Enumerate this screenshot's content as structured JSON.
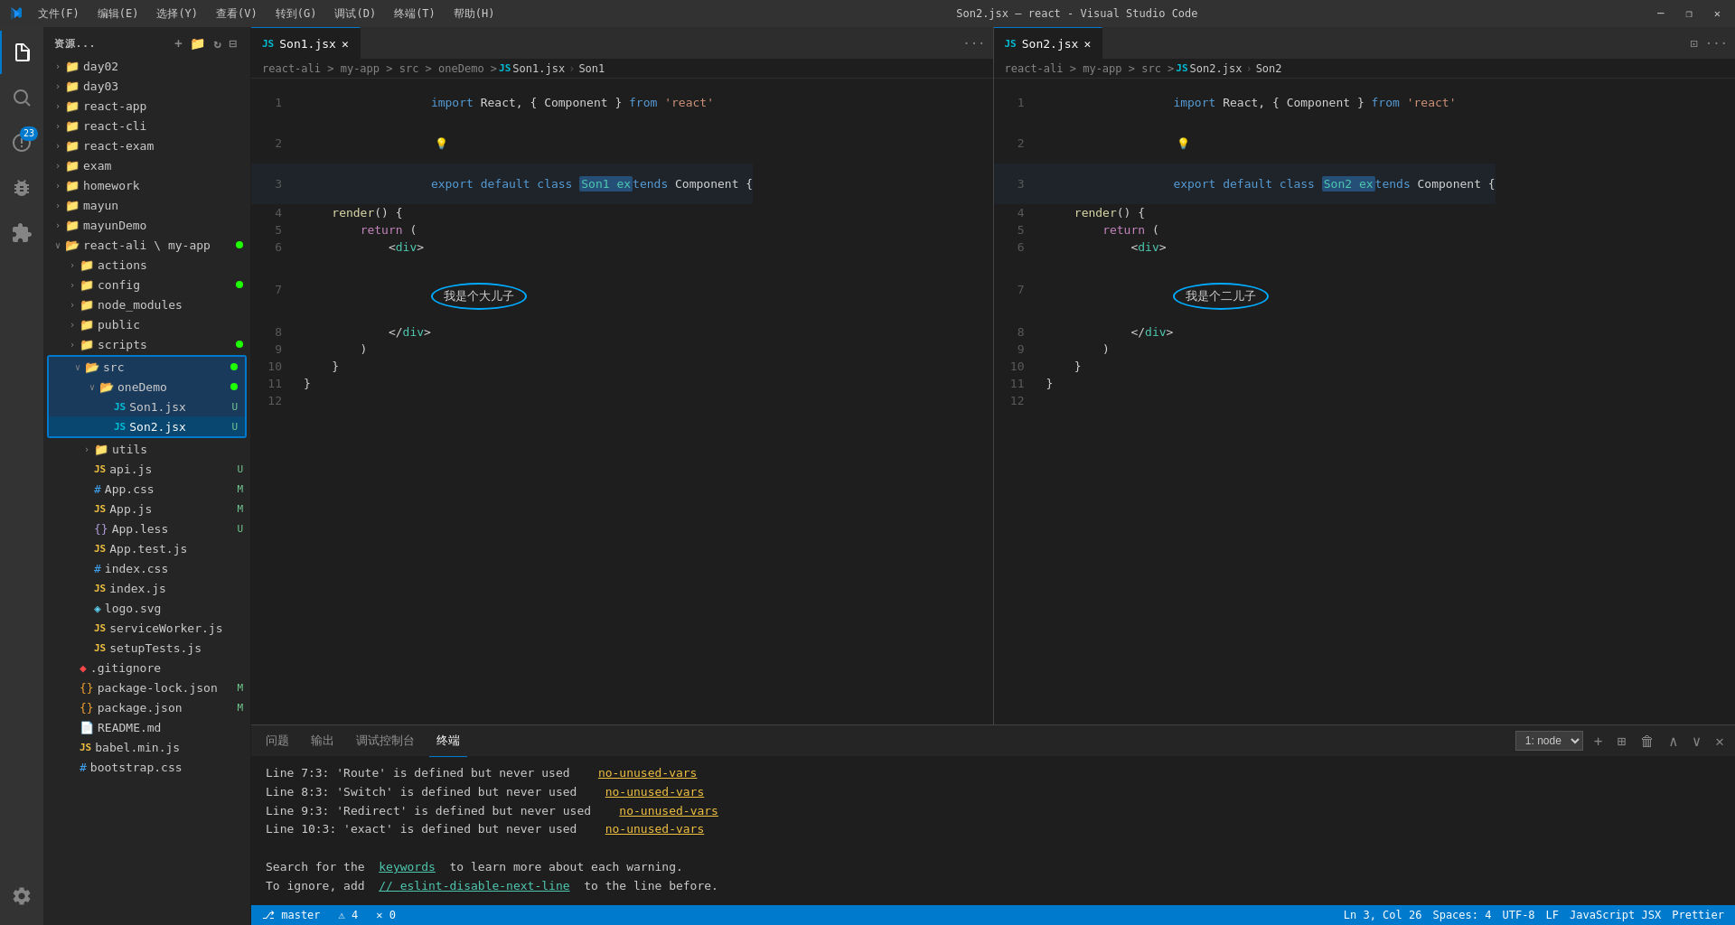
{
  "titleBar": {
    "title": "Son2.jsx — react - Visual Studio Code",
    "menus": [
      "文件(F)",
      "编辑(E)",
      "选择(Y)",
      "查看(V)",
      "转到(G)",
      "调试(D)",
      "终端(T)",
      "帮助(H)"
    ],
    "winButtons": [
      "—",
      "❐",
      "✕"
    ]
  },
  "sidebar": {
    "header": "资源...",
    "tree": [
      {
        "type": "folder",
        "label": "day02",
        "depth": 1,
        "open": false
      },
      {
        "type": "folder",
        "label": "day03",
        "depth": 1,
        "open": false
      },
      {
        "type": "folder",
        "label": "react-app",
        "depth": 1,
        "open": false
      },
      {
        "type": "folder",
        "label": "react-cli",
        "depth": 1,
        "open": false
      },
      {
        "type": "folder",
        "label": "react-exam",
        "depth": 1,
        "open": false
      },
      {
        "type": "folder",
        "label": "exam",
        "depth": 1,
        "open": false
      },
      {
        "type": "folder",
        "label": "homework",
        "depth": 1,
        "open": false
      },
      {
        "type": "folder",
        "label": "mayun",
        "depth": 1,
        "open": false
      },
      {
        "type": "folder",
        "label": "mayunDemo",
        "depth": 1,
        "open": false
      },
      {
        "type": "folder-open",
        "label": "react-ali \\ my-app",
        "depth": 1,
        "open": true,
        "dot": true
      },
      {
        "type": "folder",
        "label": "actions",
        "depth": 2,
        "open": false
      },
      {
        "type": "folder",
        "label": "config",
        "depth": 2,
        "open": false,
        "dot": true
      },
      {
        "type": "folder",
        "label": "node_modules",
        "depth": 2,
        "open": false
      },
      {
        "type": "folder",
        "label": "public",
        "depth": 2,
        "open": false
      },
      {
        "type": "folder",
        "label": "scripts",
        "depth": 2,
        "open": false,
        "dot": true
      },
      {
        "type": "folder-open",
        "label": "src",
        "depth": 2,
        "open": true,
        "dot": true,
        "highlighted": true
      },
      {
        "type": "folder-open",
        "label": "oneDemo",
        "depth": 3,
        "open": true,
        "dot": true,
        "highlighted": true
      },
      {
        "type": "file-jsx",
        "label": "Son1.jsx",
        "depth": 4,
        "badge": "U",
        "highlighted": true
      },
      {
        "type": "file-jsx",
        "label": "Son2.jsx",
        "depth": 4,
        "badge": "U",
        "selected": true
      },
      {
        "type": "folder",
        "label": "utils",
        "depth": 3,
        "open": false
      },
      {
        "type": "file-js",
        "label": "api.js",
        "depth": 3,
        "badge": "U"
      },
      {
        "type": "file-css",
        "label": "App.css",
        "depth": 3,
        "badge": "M"
      },
      {
        "type": "file-js",
        "label": "App.js",
        "depth": 3,
        "badge": "M"
      },
      {
        "type": "file-less",
        "label": "App.less",
        "depth": 3,
        "badge": "U"
      },
      {
        "type": "file-test",
        "label": "App.test.js",
        "depth": 3
      },
      {
        "type": "file-css",
        "label": "index.css",
        "depth": 3
      },
      {
        "type": "file-js",
        "label": "index.js",
        "depth": 3
      },
      {
        "type": "file-logo",
        "label": "logo.svg",
        "depth": 3
      },
      {
        "type": "file-js",
        "label": "serviceWorker.js",
        "depth": 3
      },
      {
        "type": "file-test",
        "label": "setupTests.js",
        "depth": 3
      },
      {
        "type": "file-git",
        "label": ".gitignore",
        "depth": 2
      },
      {
        "type": "file-json",
        "label": "package-lock.json",
        "depth": 2,
        "badge": "M"
      },
      {
        "type": "file-json",
        "label": "package.json",
        "depth": 2,
        "badge": "M"
      },
      {
        "type": "file-md",
        "label": "README.md",
        "depth": 2
      },
      {
        "type": "file-js",
        "label": "babel.min.js",
        "depth": 2
      },
      {
        "type": "file-css",
        "label": "bootstrap.css",
        "depth": 2
      }
    ]
  },
  "editor1": {
    "tab": "Son1.jsx",
    "breadcrumb": "react-ali > my-app > src > oneDemo > Son1.jsx > Son1",
    "lines": [
      {
        "num": 1,
        "code": "import React, { Component } from 'react'"
      },
      {
        "num": 2,
        "code": ""
      },
      {
        "num": 3,
        "code": "export default class Son1 extends Component {",
        "highlight": "Son1 ex"
      },
      {
        "num": 4,
        "code": "    render() {"
      },
      {
        "num": 5,
        "code": "        return ("
      },
      {
        "num": 6,
        "code": "            <div>"
      },
      {
        "num": 7,
        "code": "                我是个大儿子",
        "oval": true
      },
      {
        "num": 8,
        "code": "            </div>"
      },
      {
        "num": 9,
        "code": "        )"
      },
      {
        "num": 10,
        "code": "    }"
      },
      {
        "num": 11,
        "code": "}"
      },
      {
        "num": 12,
        "code": ""
      }
    ]
  },
  "editor2": {
    "tab": "Son2.jsx",
    "breadcrumb": "react-ali > my-app > src > Son2.jsx > Son2",
    "lines": [
      {
        "num": 1,
        "code": "import React, { Component } from 'react'"
      },
      {
        "num": 2,
        "code": ""
      },
      {
        "num": 3,
        "code": "export default class Son2 extends Component {",
        "highlight": "Son2 ex"
      },
      {
        "num": 4,
        "code": "    render() {"
      },
      {
        "num": 5,
        "code": "        return ("
      },
      {
        "num": 6,
        "code": "            <div>"
      },
      {
        "num": 7,
        "code": "                我是个二儿子",
        "oval": true
      },
      {
        "num": 8,
        "code": "            </div>"
      },
      {
        "num": 9,
        "code": "        )"
      },
      {
        "num": 10,
        "code": "    }"
      },
      {
        "num": 11,
        "code": "}"
      },
      {
        "num": 12,
        "code": ""
      }
    ]
  },
  "panel": {
    "tabs": [
      "问题",
      "输出",
      "调试控制台",
      "终端"
    ],
    "activeTab": "终端",
    "terminalSelect": "1: node",
    "lines": [
      {
        "pre": "Line 7:3:",
        "msg": "  'Route' is defined but never used",
        "link": "no-unused-vars"
      },
      {
        "pre": "Line 8:3:",
        "msg": "  'Switch' is defined but never used",
        "link": "no-unused-vars"
      },
      {
        "pre": "Line 9:3:",
        "msg": "  'Redirect' is defined but never used",
        "link": "no-unused-vars"
      },
      {
        "pre": "Line 10:3:",
        "msg": "  'exact' is defined but never used",
        "link": "no-unused-vars"
      }
    ],
    "searchMsg": "Search for the",
    "searchLink": "keywords",
    "searchPost": "to learn more about each warning.",
    "ignoreMsg": "To ignore, add",
    "ignoreLink": "// eslint-disable-next-line",
    "ignorePost": "to the line before."
  },
  "statusBar": {
    "left": [
      "⎇ master",
      "⚠ 4",
      "✕ 0"
    ],
    "right": [
      "Ln 3, Col 26",
      "Spaces: 4",
      "UTF-8",
      "LF",
      "JavaScript JSX",
      "Prettier"
    ]
  },
  "activityBar": {
    "items": [
      {
        "name": "explorer",
        "icon": "files",
        "active": true
      },
      {
        "name": "search",
        "icon": "search"
      },
      {
        "name": "source-control",
        "icon": "git",
        "badge": "23"
      },
      {
        "name": "debug",
        "icon": "debug"
      },
      {
        "name": "extensions",
        "icon": "extensions"
      }
    ]
  }
}
